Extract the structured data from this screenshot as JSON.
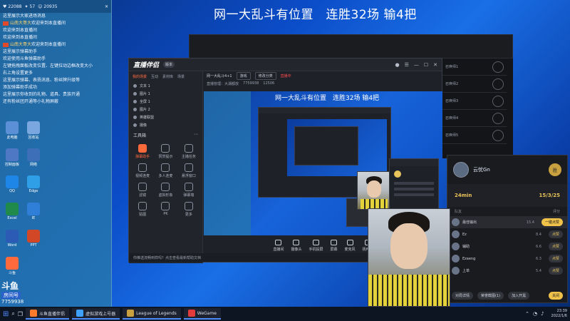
{
  "headline": "网一大乱斗有位置　连胜32场 输4把",
  "chat": {
    "stats": [
      "22088",
      "57",
      "20935"
    ],
    "lines": [
      {
        "nick": "",
        "text": "这里展示大家进场消息"
      },
      {
        "nick": "山南大哥大",
        "text": "欢迎来到本直播间"
      },
      {
        "nick": "",
        "text": "欢迎来到本直播间"
      },
      {
        "nick": "",
        "text": "欢迎来到本直播间"
      },
      {
        "nick": "山南大哥大",
        "text": "欢迎来到本直播间"
      },
      {
        "nick": "",
        "text": "这里展示弹幕助手"
      },
      {
        "nick": "",
        "text": "欢迎使用斗鱼弹幕助手"
      },
      {
        "nick": "",
        "text": "左键拖拽面板改变位置、左键拉动边框改变大小"
      },
      {
        "nick": "",
        "text": "右上角设置更多"
      },
      {
        "nick": "",
        "text": "这里展示弹幕、表扬消息、粉丝牌升级等"
      },
      {
        "nick": "",
        "text": "添加弹幕助手成功"
      },
      {
        "nick": "",
        "text": "这里展示你收到的礼物、道具、贵族开通"
      },
      {
        "nick": "",
        "text": "还有粉丝团开通等小礼物屏蔽"
      }
    ]
  },
  "desktop_icons": [
    "此电脑",
    "回收站",
    "控制面板",
    "网络",
    "QQ",
    "Edge",
    "Excel",
    "IE",
    "Word",
    "PPT",
    "斗鱼"
  ],
  "app": {
    "logo": "直播伴侣",
    "version": "版本",
    "tabs": [
      "我的场景",
      "互动",
      "素材库",
      "场景"
    ],
    "scenes": [
      "文本 1",
      "图片 1",
      "全屏 1",
      "图片 2",
      "英雄联盟",
      "摄像"
    ],
    "tools_title": "工具箱",
    "tools": [
      {
        "label": "弹幕助手",
        "active": true
      },
      {
        "label": "赞赏提示",
        "active": false
      },
      {
        "label": "主播任务",
        "active": false
      },
      {
        "label": "视频连麦",
        "active": false
      },
      {
        "label": "多人连麦",
        "active": false
      },
      {
        "label": "悬浮窗口",
        "active": false
      },
      {
        "label": "滤镜",
        "active": false
      },
      {
        "label": "虚拟形象",
        "active": false
      },
      {
        "label": "弹幕墙",
        "active": false
      },
      {
        "label": "贴图",
        "active": false
      },
      {
        "label": "PK",
        "active": false
      },
      {
        "label": "更多",
        "active": false
      }
    ],
    "notice": "你推送流畅到样吗？点击查看最新帮助文档",
    "stream_title": "网一大乱斗4+1",
    "category": "游戏",
    "edit_btn": "修改分类",
    "live_status": "直播中",
    "room_info": "直播管理：大湖都放",
    "room_id": "7759938",
    "viewers": "12506",
    "preview_headline": "网一大乱斗有位置　连胜32场 输4把",
    "controls": [
      "直播间",
      "摄像头",
      "手机投屏",
      "屏幕",
      "麦克风",
      "扬声器"
    ]
  },
  "lobby_slots": [
    "召唤师1",
    "召唤师2",
    "召唤师3",
    "召唤师4",
    "召唤师5"
  ],
  "match": {
    "name": "云忧Gn",
    "badge": "胜",
    "duration": "24min",
    "kda": "15/3/25",
    "head_left": "队友",
    "head_right": "评分",
    "rows": [
      {
        "name": "最佳输出",
        "score": "15.4",
        "btn": "一键点赞",
        "hl": true
      },
      {
        "name": "Ez",
        "score": "8.4",
        "btn": "点赞",
        "hl": false
      },
      {
        "name": "辅助",
        "score": "6.6",
        "btn": "点赞",
        "hl": false
      },
      {
        "name": "Ezaeng",
        "score": "6.3",
        "btn": "点赞",
        "hl": false
      },
      {
        "name": "上单",
        "score": "5.4",
        "btn": "点赞",
        "hl": false
      }
    ],
    "foot": [
      "对局详情",
      "荣誉截图(1)",
      "加入开黑",
      "关闭"
    ]
  },
  "watermark": {
    "logo": "斗鱼",
    "sub": "房间号",
    "id": "7759938"
  },
  "taskbar": {
    "tasks": [
      "斗鱼直播伴侣",
      "虚拟游戏上号器",
      "League of Legends",
      "WeGame"
    ],
    "time": "23:39",
    "date": "2022/1/6"
  }
}
